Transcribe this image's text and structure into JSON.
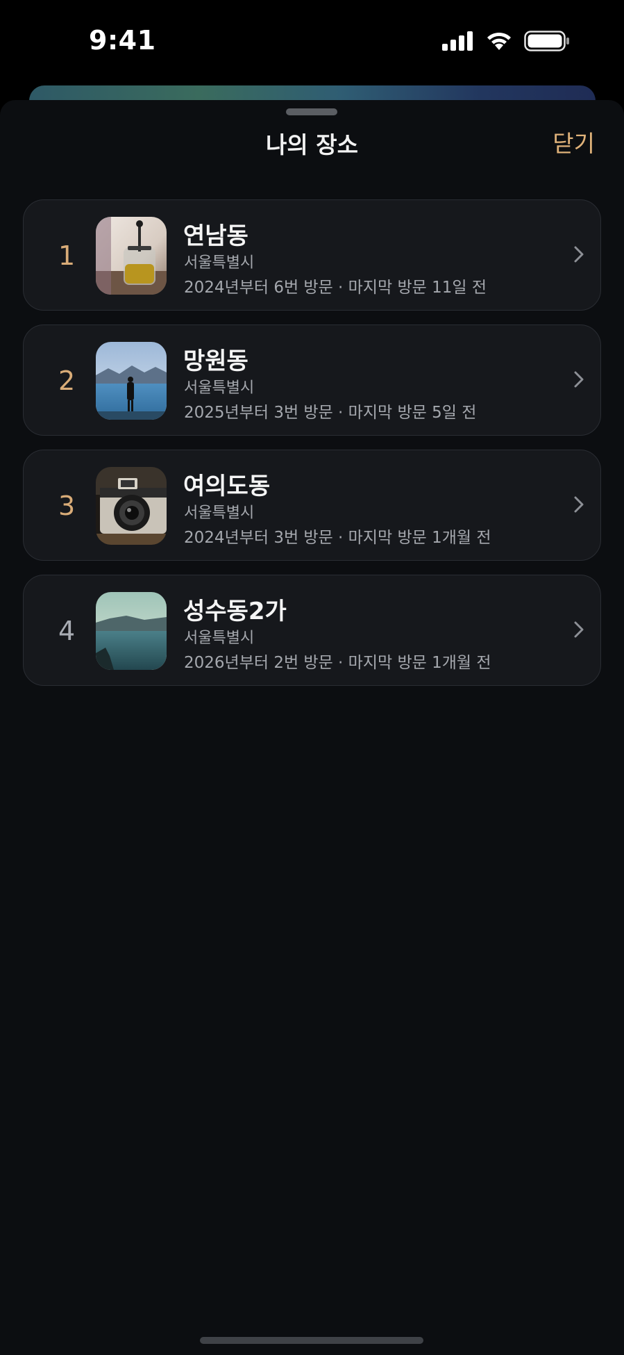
{
  "status_bar": {
    "time": "9:41"
  },
  "sheet": {
    "title": "나의 장소",
    "close_label": "닫기"
  },
  "places": [
    {
      "rank": "1",
      "name": "연남동",
      "region": "서울특별시",
      "visits": "2024년부터 6번 방문 · 마지막 방문 11일 전",
      "thumbnail": "tea-pot-photo"
    },
    {
      "rank": "2",
      "name": "망원동",
      "region": "서울특별시",
      "visits": "2025년부터 3번 방문 · 마지막 방문 5일 전",
      "thumbnail": "person-by-lake-photo"
    },
    {
      "rank": "3",
      "name": "여의도동",
      "region": "서울특별시",
      "visits": "2024년부터 3번 방문 · 마지막 방문 1개월 전",
      "thumbnail": "camera-photo"
    },
    {
      "rank": "4",
      "name": "성수동2가",
      "region": "서울특별시",
      "visits": "2026년부터 2번 방문 · 마지막 방문 1개월 전",
      "thumbnail": "lake-mountains-photo"
    }
  ],
  "colors": {
    "accent": "#e0b27a",
    "sheet_bg": "#0c0e11",
    "card_bg": "#16181c",
    "secondary_text": "#a5a8ae"
  }
}
